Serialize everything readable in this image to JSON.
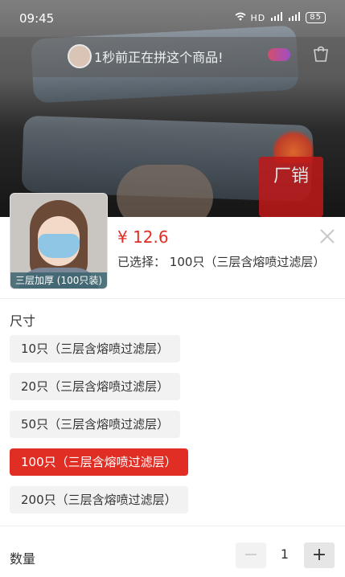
{
  "status_bar": {
    "time": "09:45",
    "signal_text": "HD",
    "battery": "85"
  },
  "notice": {
    "text": "1秒前正在拼这个商品!"
  },
  "promo": {
    "text": "厂销"
  },
  "product": {
    "thumbnail_caption": "三层加厚 (100只装)",
    "price": "¥ 12.6",
    "selected_label": "已选择：",
    "selected_value": "100只（三层含熔喷过滤层）"
  },
  "size_section": {
    "title": "尺寸",
    "options": [
      {
        "label": "10只（三层含熔喷过滤层）",
        "selected": false
      },
      {
        "label": "20只（三层含熔喷过滤层）",
        "selected": false
      },
      {
        "label": "50只（三层含熔喷过滤层）",
        "selected": false
      },
      {
        "label": "100只（三层含熔喷过滤层）",
        "selected": true
      },
      {
        "label": "200只（三层含熔喷过滤层）",
        "selected": false
      }
    ]
  },
  "quantity": {
    "label": "数量",
    "value": "1",
    "minus": "−",
    "plus": "+"
  },
  "colors": {
    "accent": "#e02e24",
    "option_bg": "#f2f2f2"
  }
}
